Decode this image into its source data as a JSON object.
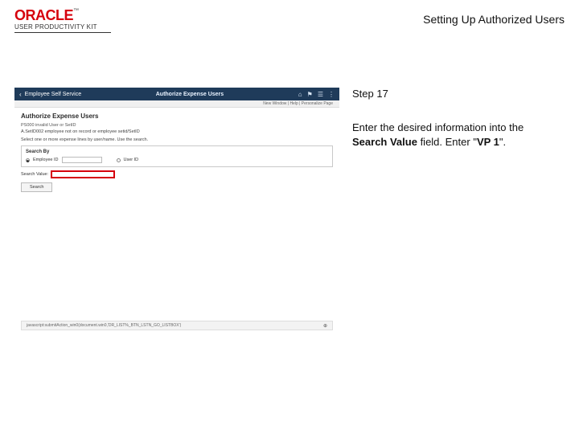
{
  "header": {
    "logo_brand": "ORACLE",
    "logo_tm": "™",
    "logo_product": "USER PRODUCTIVITY KIT",
    "doc_title": "Setting Up Authorized Users"
  },
  "screenshot": {
    "appbar": {
      "back_label": "Employee Self Service",
      "title": "Authorize Expense Users",
      "icons": {
        "home": "⌂",
        "flag": "⚑",
        "bell": "☰",
        "menu": "⋮"
      },
      "subbar": "New Window | Help | Personalize Page"
    },
    "page": {
      "title": "Authorize Expense Users",
      "subtitle": "PS000 invalid User or SetID",
      "description1": "A.SetID002 employee not on record or employee setid/SetID",
      "description2": "Select one or more expense lines by user/name. Use the search.",
      "search_by_legend": "Search By",
      "radio1": "Employee ID",
      "radio2": "User ID",
      "search_value_label": "Search Value:",
      "search_btn": "Search"
    },
    "urlbar": {
      "url": "javascript:submitAction_win0(document.win0,'DR_LIST%_BTN_LSTN_GO_LISTBOX')",
      "zoom": "⊕"
    }
  },
  "instructions": {
    "step": "Step 17",
    "line1": "Enter the desired information into the ",
    "field_name": "Search Value",
    "line2": " field. Enter \"",
    "value": "VP 1",
    "line3": "\"."
  }
}
